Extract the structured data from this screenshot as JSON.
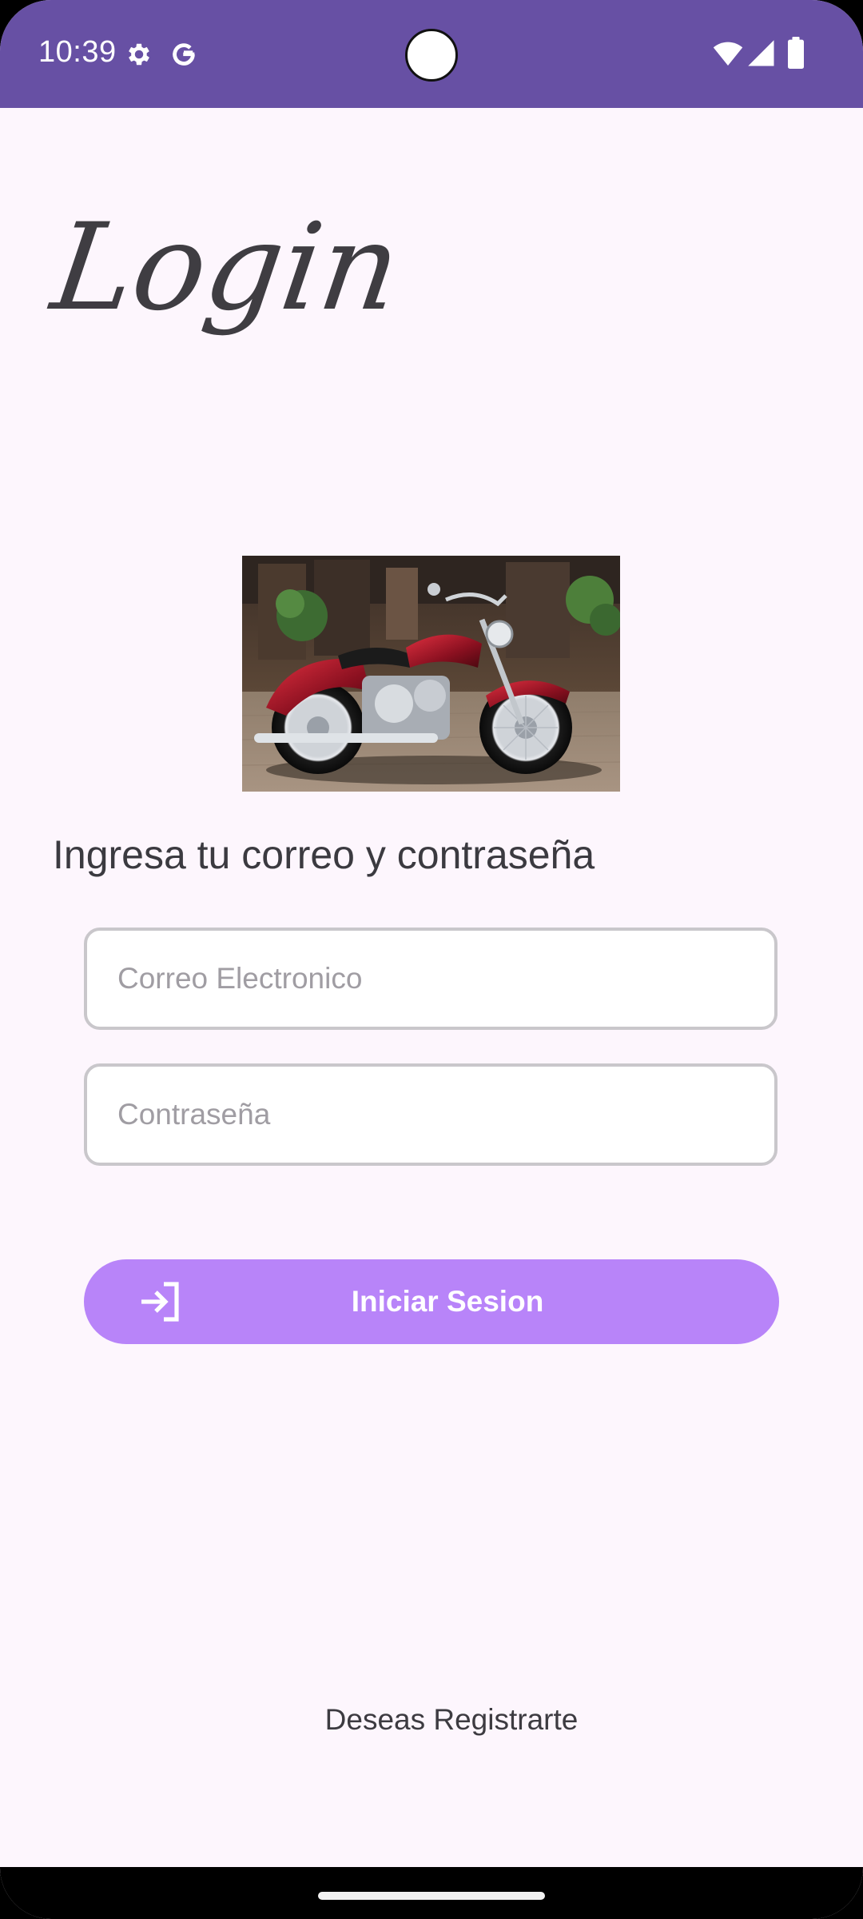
{
  "status_bar": {
    "time": "10:39",
    "icons": [
      "gear-icon",
      "google-icon",
      "wifi-icon",
      "signal-icon",
      "battery-icon"
    ],
    "background_color": "#6750a4"
  },
  "screen": {
    "title": "Login",
    "instruction": "Ingresa tu correo y contraseña"
  },
  "form": {
    "email_placeholder": "Correo Electronico",
    "email_value": "",
    "password_placeholder": "Contraseña",
    "password_value": ""
  },
  "login_button": {
    "label": "Iniciar Sesion",
    "icon": "login-arrow-icon",
    "color": "#b884f9"
  },
  "register_link": {
    "label": "Deseas Registrarte"
  },
  "colors": {
    "background": "#fdf6fd",
    "accent": "#6750a4"
  }
}
